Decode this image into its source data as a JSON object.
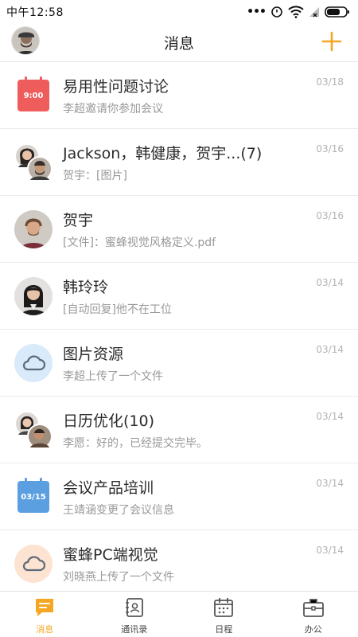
{
  "status": {
    "time": "中午12:58"
  },
  "header": {
    "title": "消息"
  },
  "colors": {
    "accent": "#f5a623",
    "calendar_red": "#ee5c5c",
    "calendar_blue": "#5b9fe0",
    "cloud_blue_bg": "#d9eafb",
    "cloud_peach_bg": "#fde3d1"
  },
  "conversations": [
    {
      "title": "易用性问题讨论",
      "subtitle": "李超邀请你参加会议",
      "date": "03/18",
      "icon": {
        "type": "calendar-icon",
        "label": "9:00"
      }
    },
    {
      "title": "Jackson，韩健康，贺宇...(7)",
      "subtitle": "贺宇：[图片]",
      "date": "03/16",
      "icon": {
        "type": "group-avatar"
      }
    },
    {
      "title": "贺宇",
      "subtitle": "[文件]：蜜蜂视觉风格定义.pdf",
      "date": "03/16",
      "icon": {
        "type": "avatar"
      }
    },
    {
      "title": "韩玲玲",
      "subtitle": "[自动回复]他不在工位",
      "date": "03/14",
      "icon": {
        "type": "avatar"
      }
    },
    {
      "title": "图片资源",
      "subtitle": "李超上传了一个文件",
      "date": "03/14",
      "icon": {
        "type": "cloud-icon"
      }
    },
    {
      "title": "日历优化(10)",
      "subtitle": "李愿：好的，已经提交完毕。",
      "date": "03/14",
      "icon": {
        "type": "group-avatar"
      }
    },
    {
      "title": "会议产品培训",
      "subtitle": "王靖涵变更了会议信息",
      "date": "03/14",
      "icon": {
        "type": "calendar-icon",
        "label": "03/15"
      }
    },
    {
      "title": "蜜蜂PC端视觉",
      "subtitle": "刘晓燕上传了一个文件",
      "date": "03/14",
      "icon": {
        "type": "cloud-icon"
      }
    }
  ],
  "tabs": [
    {
      "label": "消息",
      "icon": "chat-icon",
      "active": true
    },
    {
      "label": "通讯录",
      "icon": "contacts-icon",
      "active": false
    },
    {
      "label": "日程",
      "icon": "calendar-icon",
      "active": false
    },
    {
      "label": "办公",
      "icon": "briefcase-icon",
      "active": false
    }
  ]
}
